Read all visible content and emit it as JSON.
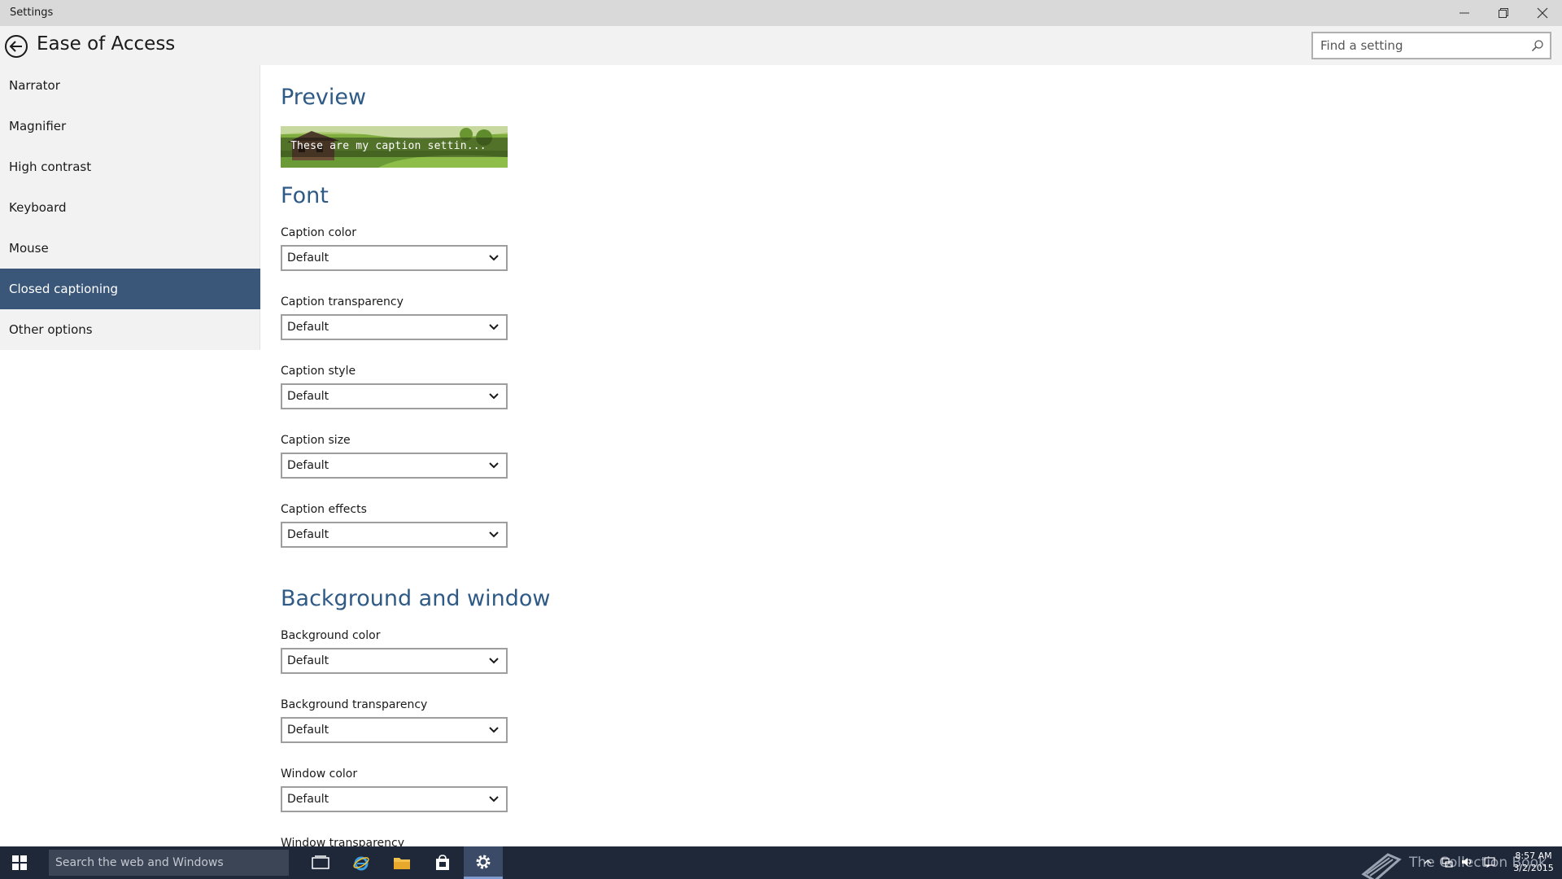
{
  "window": {
    "title": "Settings",
    "minimize_icon": "minimize-icon",
    "maximize_icon": "restore-icon",
    "close_icon": "close-icon"
  },
  "header": {
    "title": "Ease of Access",
    "back_icon": "back-arrow-icon",
    "search_placeholder": "Find a setting",
    "search_icon": "search-icon"
  },
  "sidebar": {
    "items": [
      {
        "label": "Narrator",
        "active": false
      },
      {
        "label": "Magnifier",
        "active": false
      },
      {
        "label": "High contrast",
        "active": false
      },
      {
        "label": "Keyboard",
        "active": false
      },
      {
        "label": "Mouse",
        "active": false
      },
      {
        "label": "Closed captioning",
        "active": true
      },
      {
        "label": "Other options",
        "active": false
      }
    ],
    "active_color": "#3a5779"
  },
  "main": {
    "preview": {
      "heading": "Preview",
      "caption_text": "These are my caption settin..."
    },
    "font": {
      "heading": "Font",
      "fields": [
        {
          "label": "Caption color",
          "value": "Default"
        },
        {
          "label": "Caption transparency",
          "value": "Default"
        },
        {
          "label": "Caption style",
          "value": "Default"
        },
        {
          "label": "Caption size",
          "value": "Default"
        },
        {
          "label": "Caption effects",
          "value": "Default"
        }
      ]
    },
    "background": {
      "heading": "Background and window",
      "fields": [
        {
          "label": "Background color",
          "value": "Default"
        },
        {
          "label": "Background transparency",
          "value": "Default"
        },
        {
          "label": "Window color",
          "value": "Default"
        },
        {
          "label": "Window transparency",
          "value": ""
        }
      ]
    },
    "heading_color": "#2f5a86"
  },
  "taskbar": {
    "search_placeholder": "Search the web and Windows",
    "apps": [
      "task-view-icon",
      "internet-explorer-icon",
      "file-explorer-icon",
      "store-icon",
      "settings-gear-icon"
    ],
    "watermark": "The Collection Book",
    "clock_time": "8:57 AM",
    "clock_date": "3/2/2015"
  }
}
